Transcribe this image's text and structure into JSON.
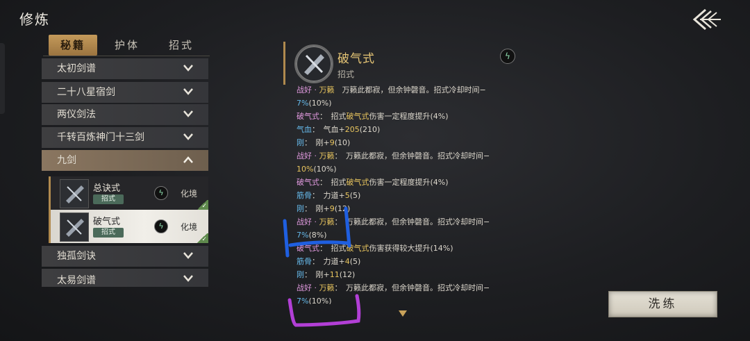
{
  "header": {
    "title": "修炼",
    "back_icon": "back-arrow-icon"
  },
  "tabs": [
    {
      "label": "秘籍",
      "active": true
    },
    {
      "label": "护体",
      "active": false
    },
    {
      "label": "招式",
      "active": false
    }
  ],
  "categories": [
    {
      "label": "太初剑谱",
      "open": false
    },
    {
      "label": "二十八星宿剑",
      "open": false
    },
    {
      "label": "两仪剑法",
      "open": false
    },
    {
      "label": "千转百炼神门十三剑",
      "open": false
    },
    {
      "label": "九剑",
      "open": true
    },
    {
      "label": "独孤剑诀",
      "open": false
    },
    {
      "label": "太易剑谱",
      "open": false
    }
  ],
  "skills": [
    {
      "name": "总诀式",
      "tag": "招式",
      "symbol": "ϟ",
      "realm": "化境",
      "selected": false
    },
    {
      "name": "破气式",
      "tag": "招式",
      "symbol": "ϟ",
      "realm": "化境",
      "selected": true
    }
  ],
  "detail": {
    "name": "破气式",
    "type": "招式",
    "symbol": "ϟ",
    "effects": [
      [
        [
          "战好 · ",
          "pink"
        ],
        [
          "万籁",
          "gold"
        ],
        [
          "　万籁此都寂，但余钟磬音。招式冷却时间−",
          "white"
        ]
      ],
      [
        [
          "7%",
          "blue"
        ],
        [
          "(10%)",
          "white"
        ]
      ],
      [
        [
          "破气式",
          "pink"
        ],
        [
          "：　招式",
          "white"
        ],
        [
          "破气式",
          "gold"
        ],
        [
          "伤害一定程度提升(4%)",
          "white"
        ]
      ],
      [
        [
          "气血",
          "blue"
        ],
        [
          "：　气血+",
          "white"
        ],
        [
          "205",
          "gold"
        ],
        [
          "(210)",
          "white"
        ]
      ],
      [
        [
          "刚",
          "blue"
        ],
        [
          "：　刚+",
          "white"
        ],
        [
          "9",
          "gold"
        ],
        [
          "(10)",
          "white"
        ]
      ],
      [
        [
          "战好 · ",
          "pink"
        ],
        [
          "万籁",
          "gold"
        ],
        [
          "：　万籁此都寂，但余钟磬音。招式冷却时间−",
          "white"
        ]
      ],
      [
        [
          "10%",
          "gold"
        ],
        [
          "(10%)",
          "white"
        ]
      ],
      [
        [
          "破气式",
          "pink"
        ],
        [
          "：　招式",
          "white"
        ],
        [
          "破气式",
          "gold"
        ],
        [
          "伤害一定程度提升(4%)",
          "white"
        ]
      ],
      [
        [
          "筋骨",
          "blue"
        ],
        [
          "：　力道+",
          "white"
        ],
        [
          "5",
          "gold"
        ],
        [
          "(5)",
          "white"
        ]
      ],
      [
        [
          "刚",
          "blue"
        ],
        [
          "：　刚+",
          "white"
        ],
        [
          "9",
          "gold"
        ],
        [
          "(12)",
          "white"
        ]
      ],
      [
        [
          "战好 · ",
          "pink"
        ],
        [
          "万籁",
          "gold"
        ],
        [
          "：　万籁此都寂，但余钟磬音。招式冷却时间−",
          "white"
        ]
      ],
      [
        [
          "7%",
          "blue"
        ],
        [
          "(8%)",
          "white"
        ]
      ],
      [
        [
          "破气式",
          "pink"
        ],
        [
          "：　招式",
          "white"
        ],
        [
          "破气式",
          "gold"
        ],
        [
          "伤害获得较大提升(14%)",
          "white"
        ]
      ],
      [
        [
          "筋骨",
          "blue"
        ],
        [
          "：　力道+",
          "white"
        ],
        [
          "4",
          "gold"
        ],
        [
          "(5)",
          "white"
        ]
      ],
      [
        [
          "刚",
          "blue"
        ],
        [
          "：　刚+",
          "white"
        ],
        [
          "11",
          "gold"
        ],
        [
          "(12)",
          "white"
        ]
      ],
      [
        [
          "战好 · ",
          "pink"
        ],
        [
          "万籁",
          "gold"
        ],
        [
          "：　万籁此都寂，但余钟磬音。招式冷却时间−",
          "white"
        ]
      ],
      [
        [
          "7%",
          "blue"
        ],
        [
          "(10%)",
          "white"
        ]
      ]
    ]
  },
  "wash_button": {
    "label": "洗练"
  },
  "colors": {
    "accent_gold": "#e7c45e",
    "tab_active": "#b08a4e",
    "annotation_blue": "#1f5fe0",
    "annotation_purple": "#b23fd6"
  }
}
